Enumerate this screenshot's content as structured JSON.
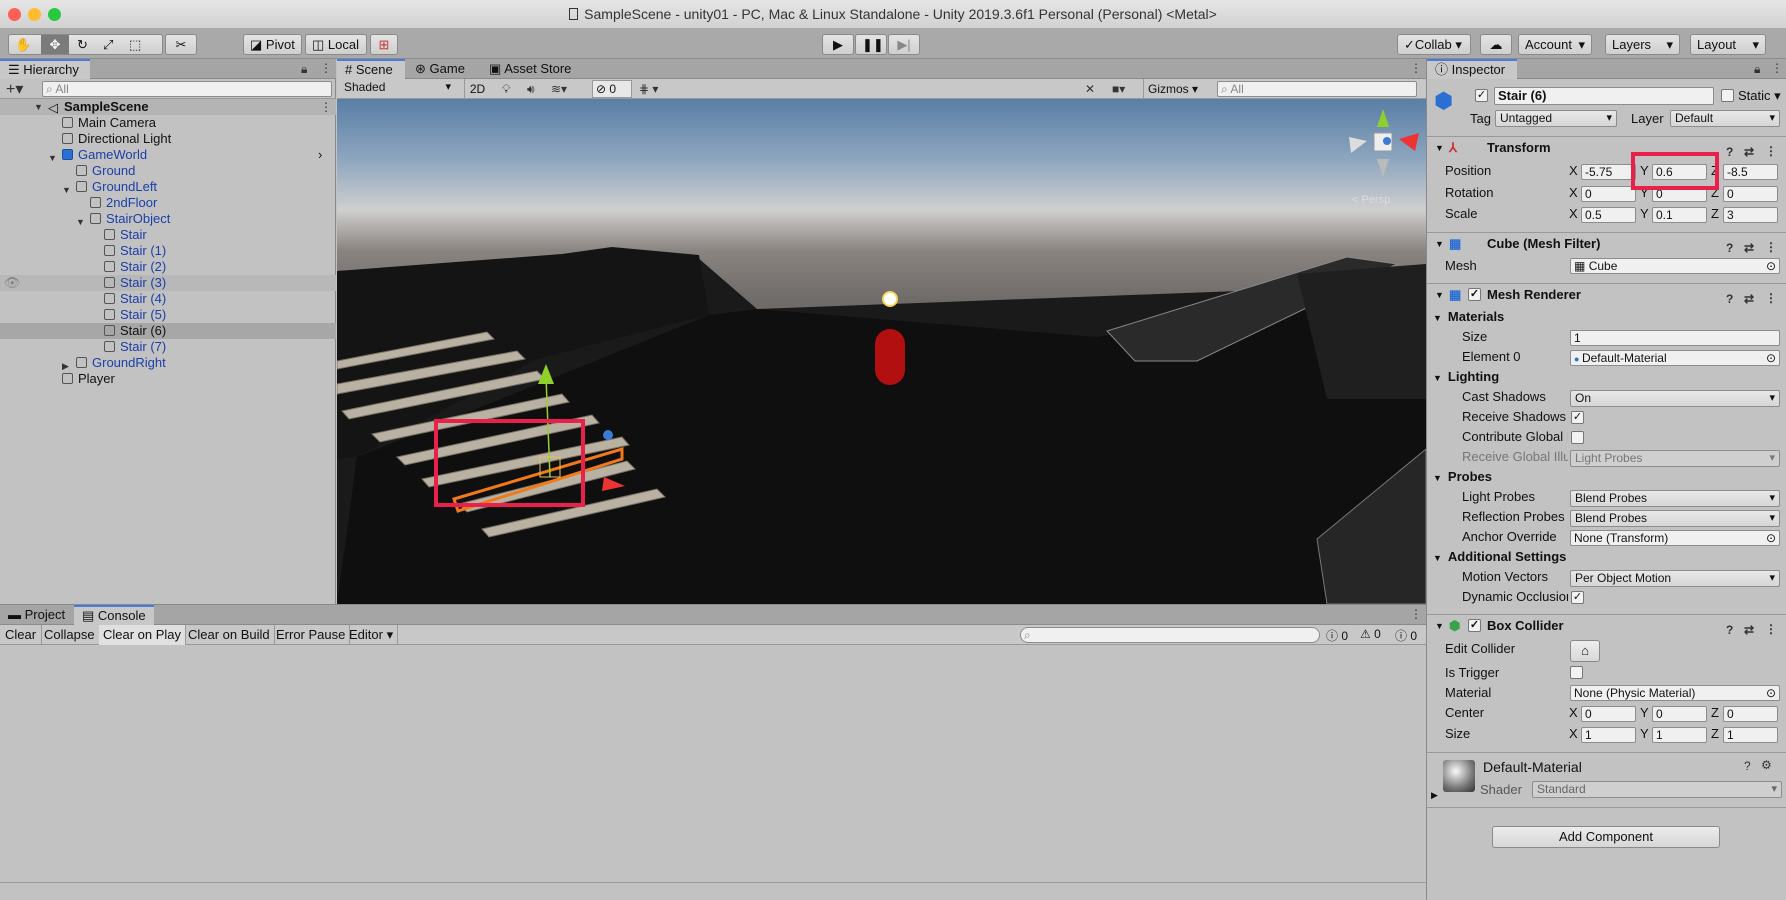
{
  "window": {
    "title": "SampleScene - unity01 - PC, Mac & Linux Standalone - Unity 2019.3.6f1 Personal (Personal) <Metal>"
  },
  "toolbar": {
    "pivot": "Pivot",
    "local": "Local",
    "collab": "Collab",
    "account": "Account",
    "layers": "Layers",
    "layout": "Layout"
  },
  "hierarchy": {
    "tab": "Hierarchy",
    "search_placeholder": "All",
    "scene": "SampleScene",
    "items": [
      "Main Camera",
      "Directional Light",
      "GameWorld",
      "Ground",
      "GroundLeft",
      "2ndFloor",
      "StairObject",
      "Stair",
      "Stair (1)",
      "Stair (2)",
      "Stair (3)",
      "Stair (4)",
      "Stair (5)",
      "Stair (6)",
      "Stair (7)",
      "GroundRight",
      "Player"
    ]
  },
  "scene_view": {
    "tabs": [
      "Scene",
      "Game",
      "Asset Store"
    ],
    "shading": "Shaded",
    "mode_2d": "2D",
    "hidden_count": "0",
    "gizmos": "Gizmos",
    "search_placeholder": "All",
    "persp": "< Persp"
  },
  "bottom": {
    "tabs": [
      "Project",
      "Console"
    ],
    "buttons": [
      "Clear",
      "Collapse",
      "Clear on Play",
      "Clear on Build",
      "Error Pause",
      "Editor"
    ],
    "counts": [
      "0",
      "0",
      "0"
    ]
  },
  "inspector": {
    "tab": "Inspector",
    "object_name": "Stair (6)",
    "static": "Static",
    "tag_label": "Tag",
    "tag": "Untagged",
    "layer_label": "Layer",
    "layer": "Default",
    "transform": {
      "title": "Transform",
      "position_label": "Position",
      "position": [
        "-5.75",
        "0.6",
        "-8.5"
      ],
      "rotation_label": "Rotation",
      "rotation": [
        "0",
        "0",
        "0"
      ],
      "scale_label": "Scale",
      "scale": [
        "0.5",
        "0.1",
        "3"
      ]
    },
    "mesh_filter": {
      "title": "Cube (Mesh Filter)",
      "mesh_label": "Mesh",
      "mesh": "Cube"
    },
    "mesh_renderer": {
      "title": "Mesh Renderer",
      "materials": "Materials",
      "size_label": "Size",
      "size": "1",
      "element0_label": "Element 0",
      "element0": "Default-Material",
      "lighting": "Lighting",
      "cast_shadows_label": "Cast Shadows",
      "cast_shadows": "On",
      "receive_shadows_label": "Receive Shadows",
      "contribute_gi_label": "Contribute Global Il",
      "receive_gi_label": "Receive Global Illu",
      "receive_gi": "Light Probes",
      "probes": "Probes",
      "light_probes_label": "Light Probes",
      "light_probes": "Blend Probes",
      "reflection_probes_label": "Reflection Probes",
      "reflection_probes": "Blend Probes",
      "anchor_override_label": "Anchor Override",
      "anchor_override": "None (Transform)",
      "additional": "Additional Settings",
      "motion_vectors_label": "Motion Vectors",
      "motion_vectors": "Per Object Motion",
      "dynamic_occlusion_label": "Dynamic Occlusion"
    },
    "box_collider": {
      "title": "Box Collider",
      "edit_collider_label": "Edit Collider",
      "is_trigger_label": "Is Trigger",
      "material_label": "Material",
      "material": "None (Physic Material)",
      "center_label": "Center",
      "center": [
        "0",
        "0",
        "0"
      ],
      "size_label": "Size",
      "size": [
        "1",
        "1",
        "1"
      ]
    },
    "material": {
      "name": "Default-Material",
      "shader_label": "Shader",
      "shader": "Standard"
    },
    "add_component": "Add Component"
  },
  "axis_labels": {
    "x": "X",
    "y": "Y",
    "z": "Z"
  },
  "colors": {
    "highlight": "#e8204a",
    "selection_orange": "#f07a1a",
    "accent_blue": "#4a7bd8"
  }
}
